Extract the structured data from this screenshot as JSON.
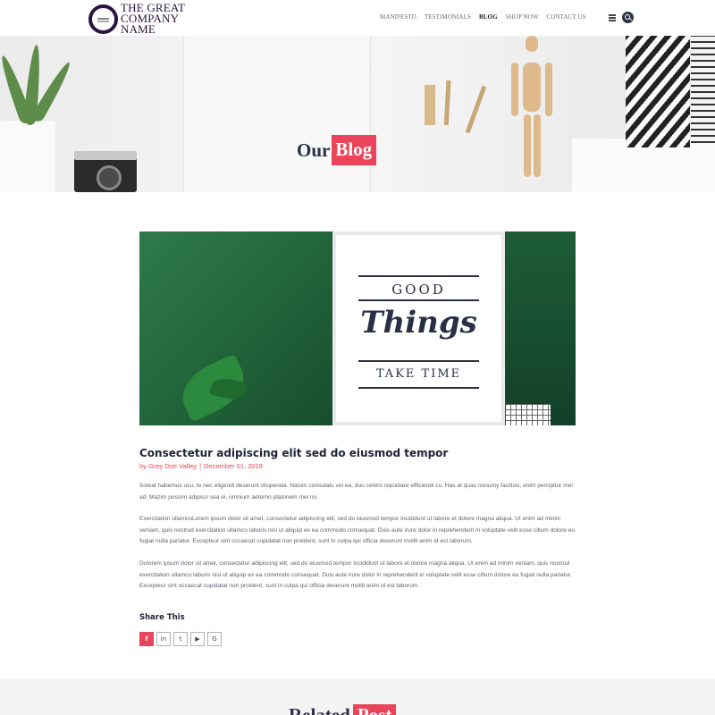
{
  "header": {
    "logo_line1": "THE GREAT",
    "logo_line2": "COMPANY NAME",
    "nav": [
      {
        "label": "MANIFESTO",
        "active": false
      },
      {
        "label": "TESTIMONIALS",
        "active": false
      },
      {
        "label": "BLOG",
        "active": true
      },
      {
        "label": "SHOP NOW",
        "active": false
      },
      {
        "label": "CONTACT US",
        "active": false
      }
    ],
    "icons": [
      "menu-icon",
      "search-icon"
    ]
  },
  "hero": {
    "title_part1": "Our",
    "title_part2": "Blog"
  },
  "post": {
    "title": "Consectetur adipiscing elit sed do eiusmod tempor",
    "author": "by Grey Doe Valley",
    "date": "December 01, 2018",
    "image_text": {
      "line1": "GOOD",
      "line2": "Things",
      "line3": "TAKE TIME"
    },
    "paragraphs": [
      "Soleat habemus usu, te nec eligendi deserunt vituperata. Natum consulatu vel ea, duo cetero repudiare efficiendi cu. Has at quas nonumy facilisis, enim percipitur mei ad. Mazim possim adipisci sea ei, omnium aeterno platonem mei no.",
      "Exercitation ullamcoLorem ipsum dolor sit amet, consectetur adipiscing elit, sed do eiusmod tempor incididunt ut labore et dolore magna aliqua. Ut enim ad minim veniam, quis nostrud exercitation ullamco laboris nisi ut aliquip ex ea commodo consequat. Duis aute irure dolor in reprehenderit in voluptate velit esse cillum dolore eu fugiat nulla pariatur. Excepteur sint occaecat cupidatat non proident, sunt in culpa qui officia deserunt mollit anim id est laborum.",
      "Dolorem ipsum dolor sit amet, consectetur adipiscing elit, sed do eiusmod tempor incididunt ut labore et dolore magna aliqua. Ut enim ad minim veniam, quis nostrud exercitation ullamco laboris nisi ut aliquip ex ea commodo consequat. Duis aute irure dolor in reprehenderit in voluptate velit esse cillum dolore eu fugiat nulla pariatur. Excepteur sint occaecat cupidatat non proident, sunt in culpa qui officia deserunt mollit anim id est laborum."
    ]
  },
  "share": {
    "title": "Share This",
    "buttons": [
      {
        "icon": "facebook-icon",
        "glyph": "f"
      },
      {
        "icon": "linkedin-icon",
        "glyph": "in"
      },
      {
        "icon": "twitter-icon",
        "glyph": "t"
      },
      {
        "icon": "youtube-icon",
        "glyph": "▶"
      },
      {
        "icon": "google-icon",
        "glyph": "G"
      }
    ]
  },
  "related": {
    "title_part1": "Related",
    "title_part2": "Post"
  },
  "colors": {
    "accent": "#e94459",
    "navy": "#2a2f45",
    "body_text": "#5f6270"
  }
}
